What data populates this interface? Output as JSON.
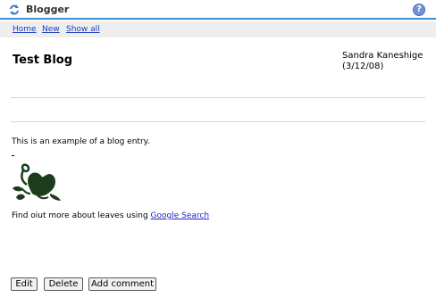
{
  "app": {
    "title": "Blogger",
    "help_label": "?"
  },
  "nav": {
    "home": "Home",
    "new": "New",
    "show_all": "Show all"
  },
  "entry": {
    "title": "Test Blog",
    "author": "Sandra Kaneshige",
    "date": "(3/12/08)",
    "body_text": "This is an example of a blog entry.",
    "image": "leaf-image",
    "more_prefix": "Find oiut more about leaves using ",
    "more_link": "Google Search"
  },
  "actions": {
    "edit": "Edit",
    "delete": "Delete",
    "add_comment": "Add comment"
  },
  "colors": {
    "accent": "#3f8fcf",
    "link": "#1a3fbf",
    "leaf": "#1b3d1b"
  },
  "icons": {
    "app": "refresh-arrows-icon",
    "help": "help-icon"
  }
}
